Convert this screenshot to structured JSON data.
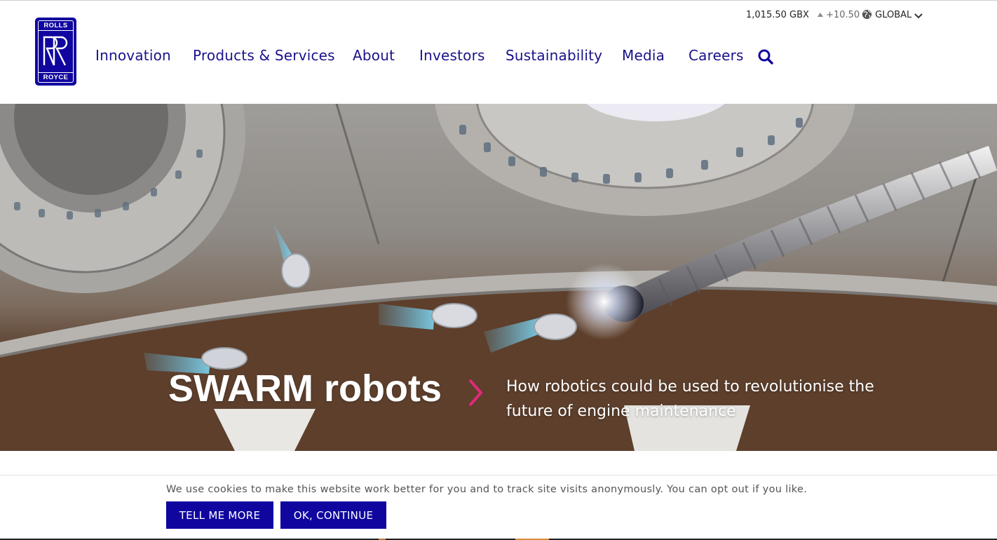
{
  "brand": {
    "name_top": "ROLLS",
    "name_bottom": "ROYCE",
    "monogram": "RR"
  },
  "stock": {
    "price": "1,015.50 GBX",
    "change": "+10.50",
    "direction_icon": "triangle-up-icon"
  },
  "region": {
    "label": "GLOBAL",
    "icon": "globe-icon"
  },
  "nav": {
    "items": [
      {
        "label": "Innovation"
      },
      {
        "label": "Products & Services"
      },
      {
        "label": "About"
      },
      {
        "label": "Investors"
      },
      {
        "label": "Sustainability"
      },
      {
        "label": "Media"
      },
      {
        "label": "Careers"
      }
    ],
    "search_icon": "search-icon"
  },
  "hero": {
    "title": "SWARM robots",
    "subtitle": "How robotics could be used to revolutionise the future of engine maintenance",
    "link_icon": "chevron-right-icon"
  },
  "cookie": {
    "message": "We use cookies to make this website work better for you and to track site visits anonymously. You can opt out if you like.",
    "more_label": "TELL ME MORE",
    "ok_label": "OK, CONTINUE"
  },
  "colors": {
    "brand_blue": "#10069f",
    "nav_text": "#1a128a",
    "accent_pink": "#e0297a"
  }
}
